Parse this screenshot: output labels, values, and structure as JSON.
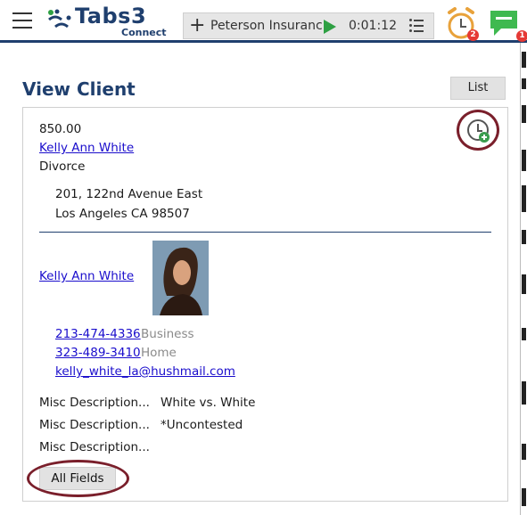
{
  "header": {
    "logo_main": "Tabs3",
    "logo_sub": "Connect",
    "timer": {
      "matter": "Peterson Insuranc",
      "elapsed": "0:01:12"
    },
    "alarm_badge": "2",
    "chat_badge": "1",
    "icons": [
      "menu-icon",
      "tabs3-logo",
      "plus-icon",
      "play-icon",
      "list-icon",
      "alarm-clock-icon",
      "chat-icon"
    ],
    "colors": {
      "brand": "#1f3f6e",
      "play": "#2ea043",
      "badge": "#e53935",
      "annotation": "#7a1f2b"
    }
  },
  "page": {
    "title": "View Client",
    "list_label": "List"
  },
  "client": {
    "amount": "850.00",
    "name": "Kelly Ann White",
    "matter_type": "Divorce",
    "address_line1": "201, 122nd Avenue East",
    "address_line2": "Los Angeles CA 98507",
    "contact_name": "Kelly Ann White",
    "phones": [
      {
        "number": "213-474-4336",
        "type": "Business"
      },
      {
        "number": "323-489-3410",
        "type": "Home"
      }
    ],
    "email": "kelly_white_la@hushmail.com",
    "misc": [
      {
        "label": "Misc Description...",
        "value": "White vs. White"
      },
      {
        "label": "Misc Description...",
        "value": "*Uncontested"
      },
      {
        "label": "Misc Description...",
        "value": ""
      }
    ],
    "all_fields_label": "All Fields"
  }
}
